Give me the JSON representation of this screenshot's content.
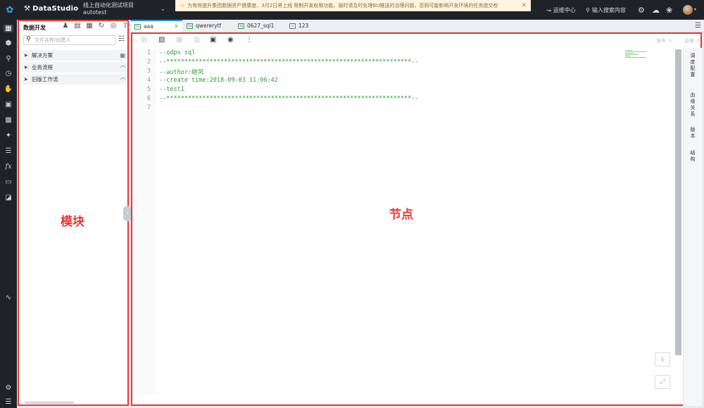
{
  "topbar": {
    "app_name": "DataStudio",
    "project_name": "线上自动化测试项目",
    "project_sub": "autotest",
    "notice": "为有效提升集团数据资产健康度，3月2日将上线 限制开发权限功能，届时请及时处理BU推送的治理问题，否则可能影响开发环境的任务提交权",
    "ops_center": "运维中心",
    "search_placeholder": "输入搜索内容"
  },
  "module": {
    "title": "数据开发",
    "search_placeholder": "文件名称/创建人",
    "tree": [
      {
        "label": "解决方案"
      },
      {
        "label": "业务流程"
      },
      {
        "label": "旧版工作流"
      }
    ],
    "annotation": "模块"
  },
  "tabs": [
    {
      "label": "aaa",
      "active": true,
      "icon": "sql-icon"
    },
    {
      "label": "qwererytf",
      "active": false,
      "icon": "sql-icon"
    },
    {
      "label": "0627_sql1",
      "active": false,
      "icon": "sql-icon"
    },
    {
      "label": "123",
      "active": false,
      "icon": "workflow-icon"
    }
  ],
  "editor": {
    "right_actions": [
      "发布 ↗",
      "运维 ↗"
    ],
    "lines": [
      {
        "n": "1",
        "text": "--odps sql"
      },
      {
        "n": "2",
        "text": "--********************************************************************--"
      },
      {
        "n": "3",
        "text": "--author:继风"
      },
      {
        "n": "4",
        "text": "--create time:2018-09-03 11:06:42"
      },
      {
        "n": "5",
        "text": "--test1"
      },
      {
        "n": "6",
        "text": "--********************************************************************--"
      },
      {
        "n": "7",
        "text": ""
      }
    ],
    "annotation": "节点"
  },
  "side_panel": {
    "items": [
      "调度配置",
      "血缘关系",
      "版本",
      "结构"
    ]
  },
  "colors": {
    "accent": "#1e90e8",
    "annotation_red": "#e53935",
    "code_green": "#2e9e2e",
    "topbar_bg": "#1f2328"
  }
}
